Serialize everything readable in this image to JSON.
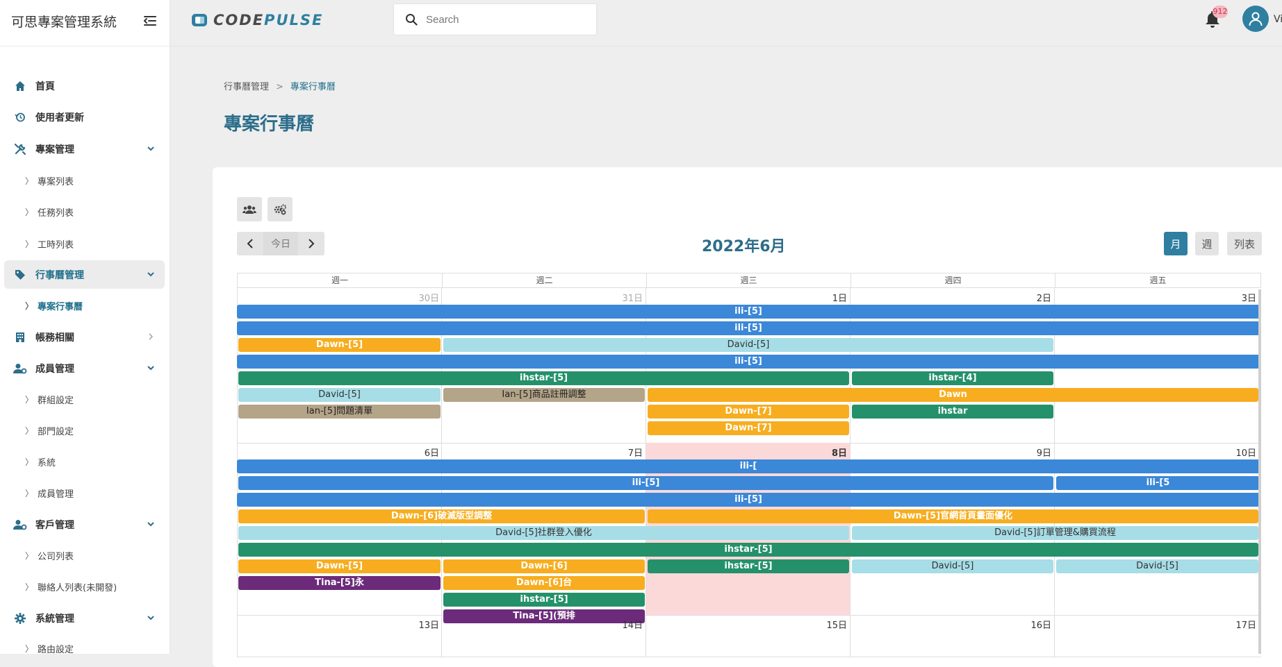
{
  "app": {
    "title": "可思專案管理系統",
    "logo_text": "CODEPULSE"
  },
  "header": {
    "search_placeholder": "Search",
    "notification_count": "912",
    "user_name": "Vi"
  },
  "sidebar": {
    "items": [
      {
        "label": "首頁",
        "icon": "home-icon"
      },
      {
        "label": "使用者更新",
        "icon": "history-icon"
      },
      {
        "label": "專案管理",
        "icon": "tools-icon",
        "expanded": true
      },
      {
        "label": "專案列表"
      },
      {
        "label": "任務列表"
      },
      {
        "label": "工時列表"
      },
      {
        "label": "行事曆管理",
        "icon": "tag-icon",
        "expanded": true,
        "active": true
      },
      {
        "label": "專案行事曆",
        "active": true
      },
      {
        "label": "帳務相關",
        "icon": "building-icon",
        "expanded": false
      },
      {
        "label": "成員管理",
        "icon": "users-cog-icon",
        "expanded": true
      },
      {
        "label": "群組設定"
      },
      {
        "label": "部門設定"
      },
      {
        "label": "系統"
      },
      {
        "label": "成員管理"
      },
      {
        "label": "客戶管理",
        "icon": "users-cog-icon",
        "expanded": true
      },
      {
        "label": "公司列表"
      },
      {
        "label": "聯絡人列表(未開發)"
      },
      {
        "label": "系統管理",
        "icon": "gear-icon",
        "expanded": true
      },
      {
        "label": "路由設定"
      }
    ]
  },
  "breadcrumb": {
    "parent": "行事曆管理",
    "separator": ">",
    "current": "專案行事曆"
  },
  "page_title": "專案行事曆",
  "calendar": {
    "title": "2022年6月",
    "today_label": "今日",
    "views": {
      "month": "月",
      "week": "週",
      "list": "列表"
    },
    "active_view": "month",
    "weekdays": [
      "週一",
      "週二",
      "週三",
      "週四",
      "週五"
    ],
    "weeks": [
      {
        "days": [
          "30日",
          "31日",
          "1日",
          "2日",
          "3日"
        ],
        "events": [
          {
            "label": "ili-[5]",
            "color": "blue"
          },
          {
            "label": "ili-[5]",
            "color": "blue"
          },
          {
            "label": "Dawn-[5]",
            "color": "orange"
          },
          {
            "label": "David-[5]",
            "color": "light"
          },
          {
            "label": "ili-[5]",
            "color": "blue"
          },
          {
            "label": "ihstar-[5]",
            "color": "green"
          },
          {
            "label": "ihstar-[4]",
            "color": "green"
          },
          {
            "label": "David-[5]",
            "color": "light"
          },
          {
            "label": "Ian-[5]商品註冊調整",
            "color": "tan"
          },
          {
            "label": "Dawn",
            "color": "orange"
          },
          {
            "label": "Ian-[5]問題清單",
            "color": "tan"
          },
          {
            "label": "Dawn-[7]",
            "color": "orange"
          },
          {
            "label": "ihstar",
            "color": "green"
          },
          {
            "label": "Dawn-[7]",
            "color": "orange"
          }
        ]
      },
      {
        "days": [
          "6日",
          "7日",
          "8日",
          "9日",
          "10日"
        ],
        "today_index": 2,
        "events": [
          {
            "label": "ili-[",
            "color": "blue"
          },
          {
            "label": "ili-[5]",
            "color": "blue"
          },
          {
            "label": "ili-[5]",
            "color": "blue"
          },
          {
            "label": "ili-[5",
            "color": "blue"
          },
          {
            "label": "Dawn-[6]破滅版型調整",
            "color": "orange"
          },
          {
            "label": "Dawn-[5]官網首頁畫面優化",
            "color": "orange"
          },
          {
            "label": "David-[5]社群登入優化",
            "color": "light"
          },
          {
            "label": "David-[5]訂單管理&購買流程",
            "color": "light"
          },
          {
            "label": "ihstar-[5]",
            "color": "green"
          },
          {
            "label": "Dawn-[5]",
            "color": "orange"
          },
          {
            "label": "Dawn-[6]",
            "color": "orange"
          },
          {
            "label": "ihstar-[5]",
            "color": "green"
          },
          {
            "label": "David-[5]",
            "color": "light"
          },
          {
            "label": "David-[5]",
            "color": "light"
          },
          {
            "label": "Tina-[5]永",
            "color": "purple"
          },
          {
            "label": "Dawn-[6]台",
            "color": "orange"
          },
          {
            "label": "ihstar-[5]",
            "color": "green"
          },
          {
            "label": "Tina-[5](預排",
            "color": "purple"
          }
        ]
      },
      {
        "days": [
          "13日",
          "14日",
          "15日",
          "16日",
          "17日"
        ],
        "events": []
      }
    ]
  }
}
